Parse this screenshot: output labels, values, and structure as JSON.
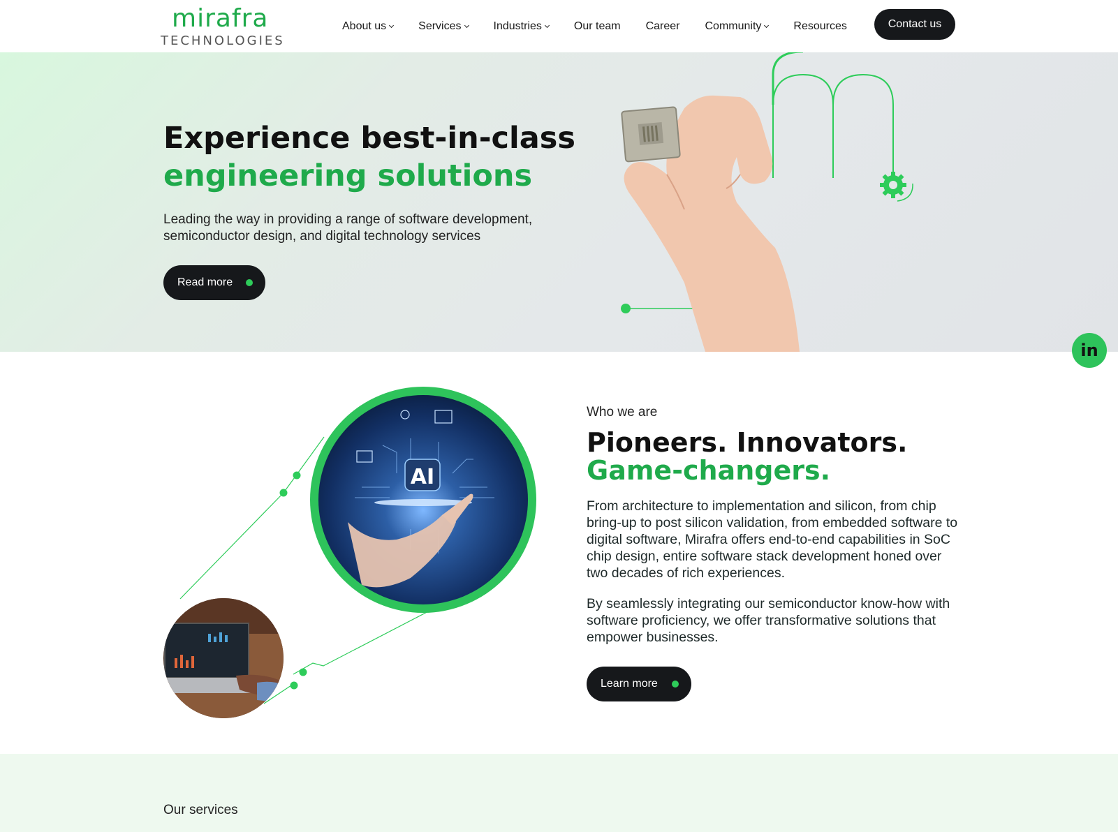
{
  "brand": {
    "name": "mirafra",
    "subtitle": "TECHNOLOGIES",
    "color": "#1faa4b"
  },
  "nav": {
    "items": [
      {
        "label": "About us",
        "dropdown": true
      },
      {
        "label": "Services",
        "dropdown": true
      },
      {
        "label": "Industries",
        "dropdown": true
      },
      {
        "label": "Our team",
        "dropdown": false
      },
      {
        "label": "Career",
        "dropdown": false
      },
      {
        "label": "Community",
        "dropdown": true
      },
      {
        "label": "Resources",
        "dropdown": false
      }
    ],
    "contact_label": "Contact us"
  },
  "hero": {
    "title_line1": "Experience best-in-class",
    "title_line2": "engineering solutions",
    "subtitle": "Leading the way in providing a range of software development, semiconductor design, and digital technology services",
    "button_label": "Read more"
  },
  "social": {
    "linkedin_label": "in"
  },
  "about": {
    "label": "Who we are",
    "heading_line1": "Pioneers. Innovators.",
    "heading_line2": "Game-changers.",
    "paragraph1": "From architecture to implementation and silicon, from chip bring-up to post silicon validation, from embedded software to digital software, Mirafra offers end-to-end capabilities in SoC chip design, entire software stack development honed over two decades of rich experiences.",
    "paragraph2": "By seamlessly integrating our semiconductor know-how with software proficiency, we offer transformative solutions that empower businesses.",
    "button_label": "Learn more",
    "ai_badge": "AI"
  },
  "services": {
    "label": "Our services"
  },
  "colors": {
    "accent": "#2ecc5a",
    "dark_button": "#16181b"
  }
}
